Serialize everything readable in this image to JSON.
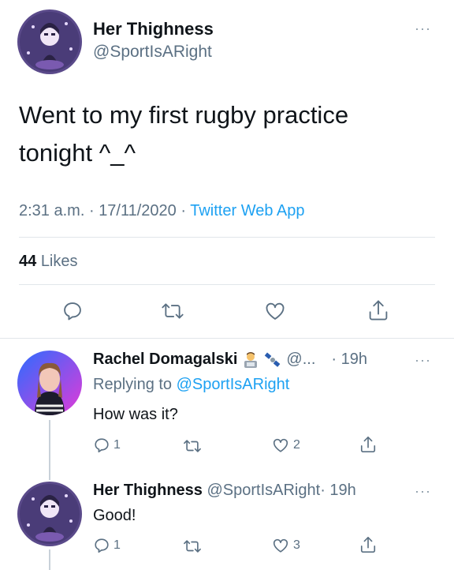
{
  "main_tweet": {
    "display_name": "Her Thighness",
    "handle": "@SportIsARight",
    "text_line1": "Went to my first rugby practice",
    "text_line2": "tonight ^_^",
    "time": "2:31 a.m.",
    "sep1": "·",
    "date": "17/11/2020",
    "sep2": "·",
    "source": "Twitter Web App",
    "likes_count": "44",
    "likes_label": "Likes",
    "more": "···"
  },
  "replies": [
    {
      "display_name": "Rachel Domagalski",
      "handle": "@...",
      "time": "· 19h",
      "replying_prefix": "Replying to",
      "replying_to": "@SportIsARight",
      "text": "How was it?",
      "reply_count": "1",
      "like_count": "2",
      "more": "···"
    },
    {
      "display_name": "Her Thighness",
      "handle": "@SportIsARight",
      "time": "· 19h",
      "text": "Good!",
      "reply_count": "1",
      "like_count": "3",
      "more": "···"
    }
  ],
  "colors": {
    "link": "#1da1f2",
    "muted": "#5b7083",
    "divider": "#e1e6ea"
  },
  "icons": [
    "reply-icon",
    "retweet-icon",
    "like-icon",
    "share-icon",
    "more-icon",
    "emoji-technologist-icon",
    "emoji-satellite-icon"
  ]
}
